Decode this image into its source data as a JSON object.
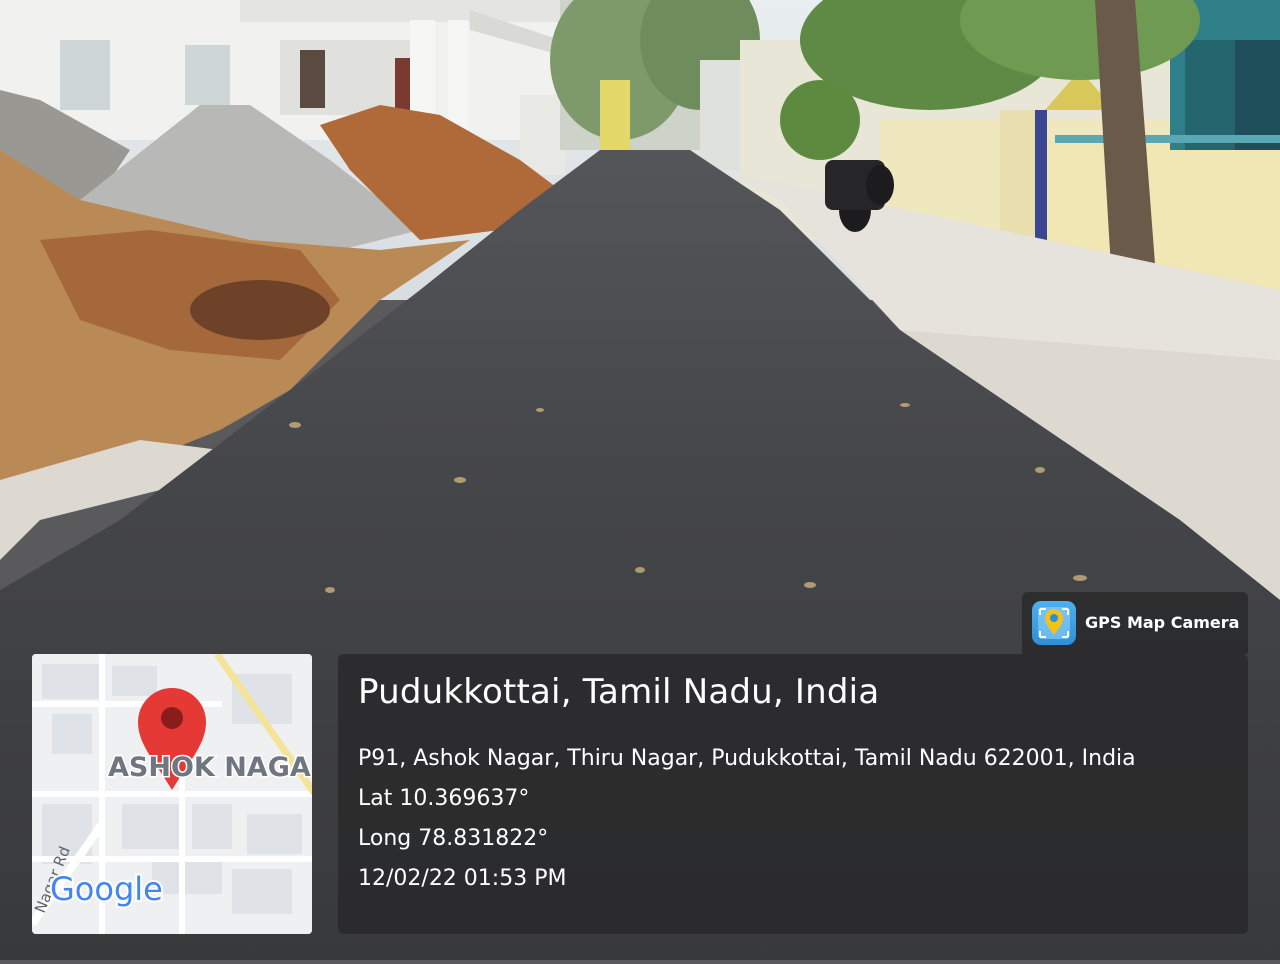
{
  "map": {
    "area_label": "ASHOK NAGA",
    "road_label": "Nagar Rd",
    "brand_label": "Google"
  },
  "badge": {
    "label": "GPS Map Camera"
  },
  "location": {
    "title": "Pudukkottai, Tamil Nadu, India",
    "address": "P91, Ashok Nagar, Thiru Nagar, Pudukkottai, Tamil Nadu 622001, India",
    "lat": "Lat 10.369637°",
    "long": "Long 78.831822°",
    "datetime": "12/02/22 01:53 PM"
  },
  "colors": {
    "asphalt": "#3a3a3d",
    "pin_red": "#e53935",
    "panel_bg": "#28282a"
  }
}
